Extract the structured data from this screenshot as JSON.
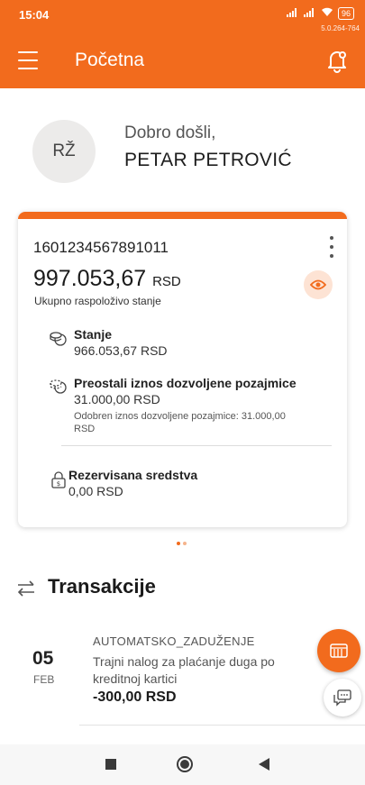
{
  "status_bar": {
    "time": "15:04",
    "battery": "96",
    "version": "5.0.264-764"
  },
  "header": {
    "title": "Početna"
  },
  "profile": {
    "initials": "RŽ",
    "greeting": "Dobro došli,",
    "name": "PETAR PETROVIĆ"
  },
  "account_card": {
    "account_number": "1601234567891011",
    "balance": "997.053,67",
    "currency": "RSD",
    "balance_label": "Ukupno raspoloživo stanje",
    "rows": [
      {
        "title": "Stanje",
        "value": "966.053,67 RSD",
        "icon": "coins-icon"
      },
      {
        "title": "Preostali iznos dozvoljene pozajmice",
        "value": "31.000,00 RSD",
        "sub": "Odobren iznos dozvoljene pozajmice: 31.000,00 RSD",
        "icon": "coins-dashed-icon"
      },
      {
        "title": "Rezervisana sredstva",
        "value": "0,00 RSD",
        "icon": "lock-icon"
      }
    ]
  },
  "carousel": {
    "active_index": 0,
    "count": 2,
    "active_color": "#f26b1d",
    "inactive_color": "#f5b48c"
  },
  "transactions": {
    "title": "Transakcije",
    "items": [
      {
        "day": "05",
        "month": "FEB",
        "type": "AUTOMATSKO_ZADUŽENJE",
        "description": "Trajni nalog za plaćanje duga po kreditnoj kartici",
        "amount": "-300,00 RSD"
      }
    ]
  },
  "colors": {
    "brand": "#f26b1d"
  }
}
